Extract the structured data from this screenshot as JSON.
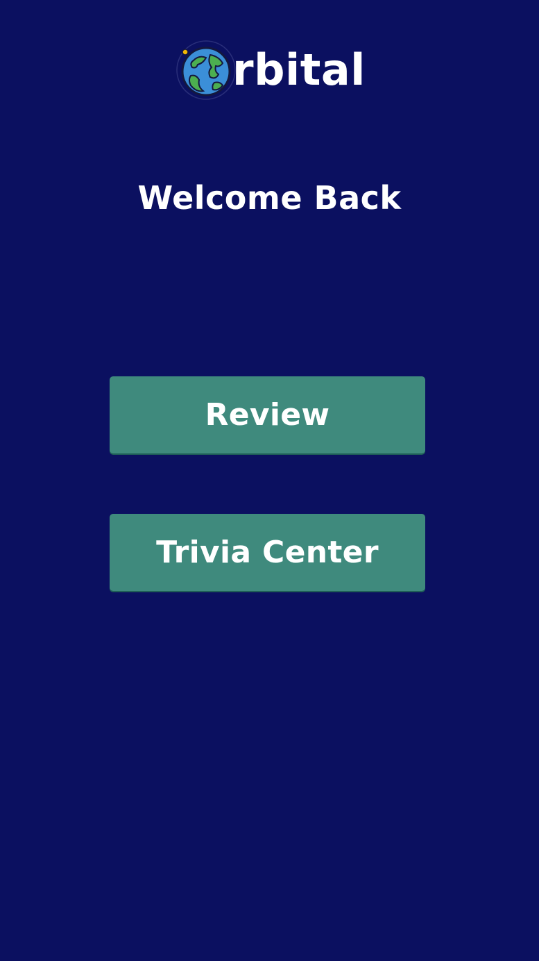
{
  "app": {
    "logo_text": "rbital",
    "logo_icon": "globe-icon"
  },
  "welcome": {
    "title": "Welcome Back"
  },
  "actions": {
    "review_label": "Review",
    "trivia_label": "Trivia Center"
  },
  "colors": {
    "background": "#0b1060",
    "button": "#3f8a7d",
    "text": "#ffffff",
    "globe_ocean": "#3b8fd8",
    "globe_land": "#4caf50"
  }
}
